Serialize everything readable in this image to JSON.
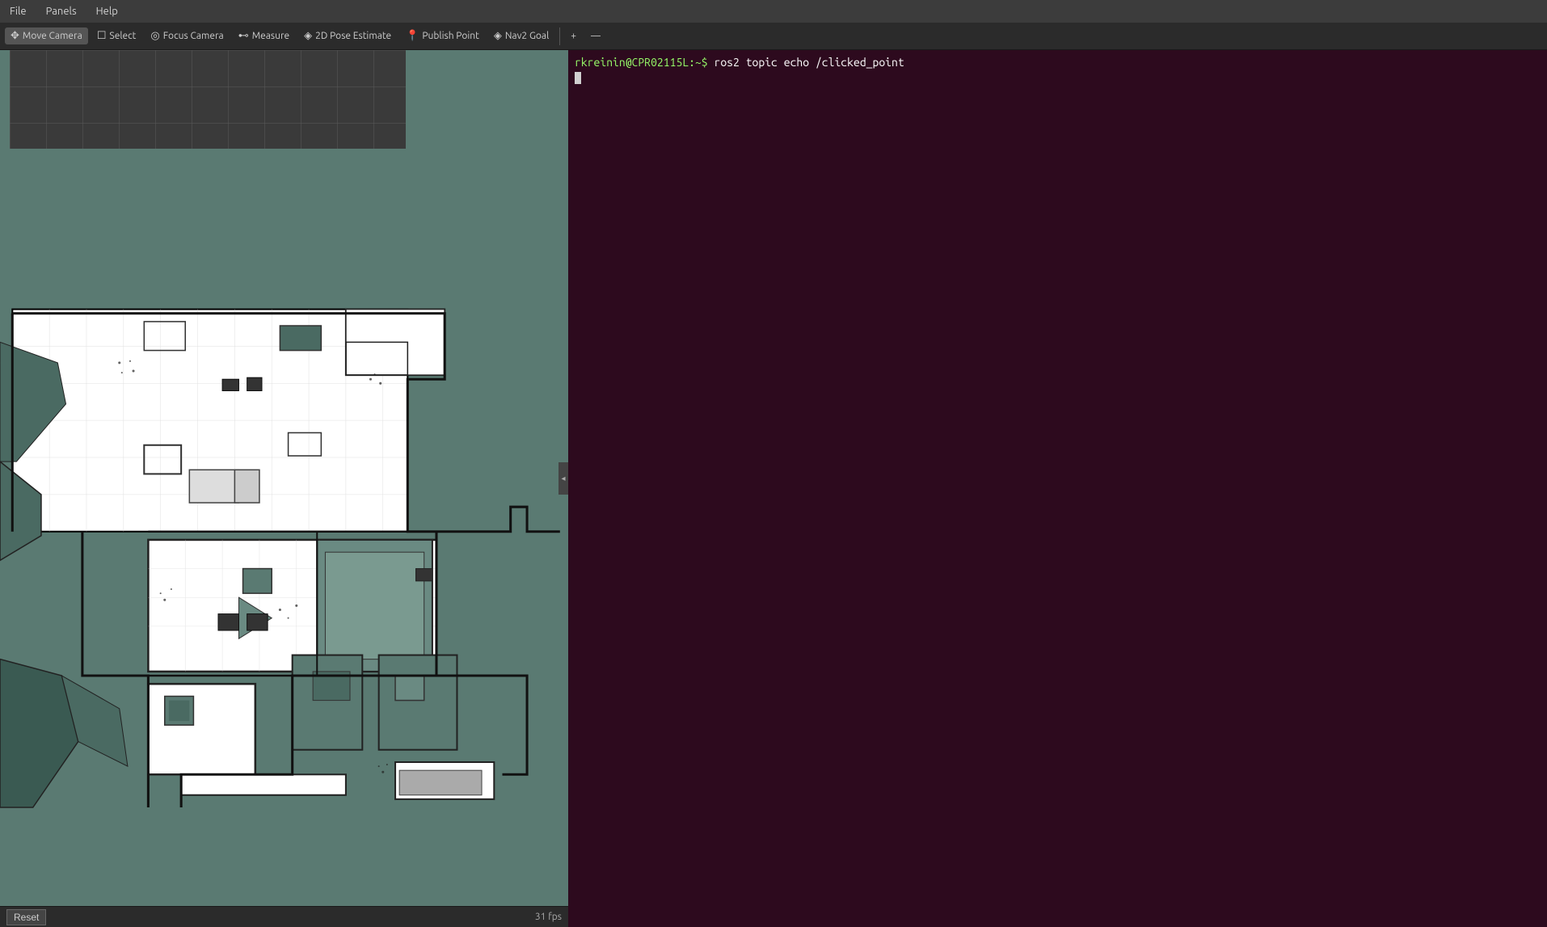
{
  "menubar": {
    "items": [
      "File",
      "Panels",
      "Help"
    ]
  },
  "toolbar": {
    "buttons": [
      {
        "id": "move-camera",
        "icon": "✥",
        "label": "Move Camera",
        "active": true
      },
      {
        "id": "select",
        "icon": "☐",
        "label": "Select",
        "active": false
      },
      {
        "id": "focus-camera",
        "icon": "◎",
        "label": "Focus Camera",
        "active": false
      },
      {
        "id": "measure",
        "icon": "⊷",
        "label": "Measure",
        "active": false
      },
      {
        "id": "pose-estimate",
        "icon": "⬦",
        "label": "2D Pose Estimate",
        "active": false
      },
      {
        "id": "publish-point",
        "icon": "📍",
        "label": "Publish Point",
        "active": false
      },
      {
        "id": "nav2-goal",
        "icon": "⬦",
        "label": "Nav2 Goal",
        "active": false
      }
    ],
    "extras": [
      "+",
      "—"
    ]
  },
  "statusbar": {
    "reset_label": "Reset",
    "fps": "31 fps"
  },
  "terminal": {
    "prompt_user": "rkreinin@CPR02115L",
    "prompt_cwd": "~",
    "command": "ros2 topic echo /clicked_point",
    "cursor_visible": true
  }
}
